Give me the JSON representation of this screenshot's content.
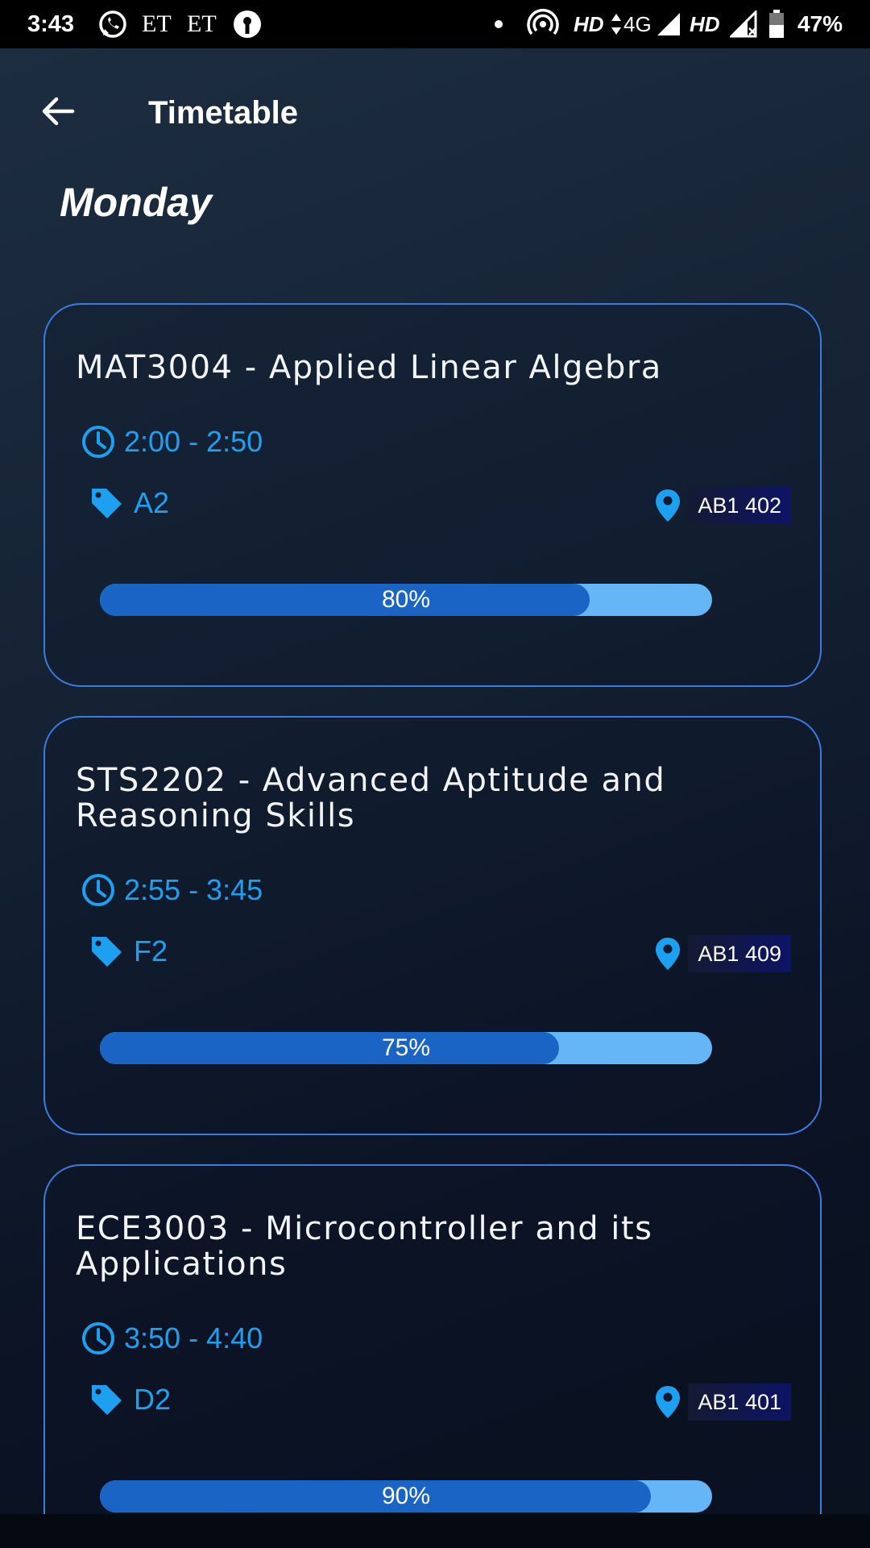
{
  "status_bar": {
    "time": "3:43",
    "whatsapp_icon": "whatsapp-icon",
    "et1": "ET",
    "et2": "ET",
    "hd1": "HD",
    "network": "4G",
    "hd2": "HD",
    "battery": "47%"
  },
  "header": {
    "title": "Timetable",
    "back_icon": "arrow-left-icon"
  },
  "day": "Monday",
  "accent_color": "#1ea0f0",
  "card_border_color": "#3b7be0",
  "classes": [
    {
      "course": "MAT3004 - Applied Linear Algebra",
      "time": "2:00 - 2:50",
      "slot": "A2",
      "room": "AB1 402",
      "attendance_label": "80%",
      "attendance": 0.8
    },
    {
      "course": "STS2202 - Advanced Aptitude and Reasoning Skills",
      "time": "2:55 - 3:45",
      "slot": "F2",
      "room": "AB1 409",
      "attendance_label": "75%",
      "attendance": 0.75
    },
    {
      "course": "ECE3003 - Microcontroller and its Applications",
      "time": "3:50 - 4:40",
      "slot": "D2",
      "room": "AB1 401",
      "attendance_label": "90%",
      "attendance": 0.9
    }
  ]
}
